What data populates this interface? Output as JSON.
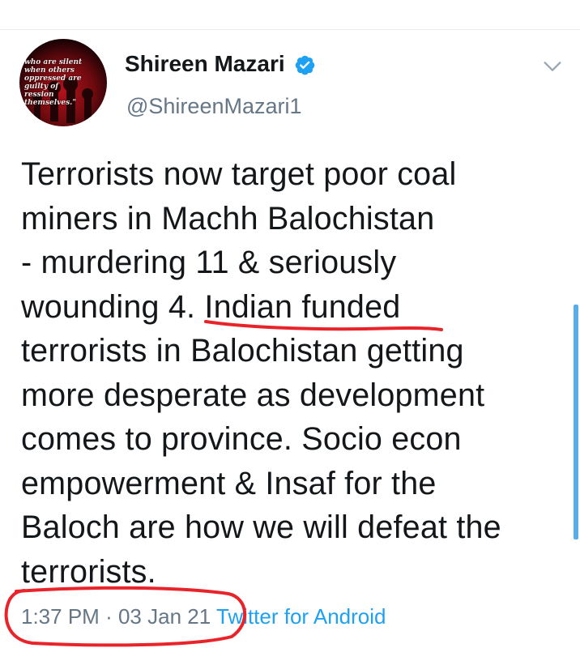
{
  "tweet": {
    "author": {
      "display_name": "Shireen Mazari",
      "handle": "@ShireenMazari1",
      "verified": true,
      "avatar_caption": "who are silent when others\noppressed are guilty of\nression themselves.\""
    },
    "text_lines": [
      "Terrorists now target poor coal",
      "miners in Machh Balochistan",
      "- murdering 11 & seriously",
      "wounding 4. Indian funded",
      "terrorists in Balochistan getting",
      "more desperate as development",
      "comes to province. Socio econ",
      "empowerment & Insaf for the",
      "Baloch are how we will defeat the",
      "terrorists."
    ],
    "time": "1:37 PM",
    "separator": "·",
    "date": "03 Jan 21",
    "source": "Twitter for Android"
  },
  "icons": {
    "verified": "verified-badge-icon",
    "more": "chevron-down-icon"
  },
  "colors": {
    "text_primary": "#14171a",
    "text_secondary": "#657786",
    "link": "#1da1f2",
    "verified_badge": "#1da1f2",
    "annotation_red": "#e8242a",
    "scrollbar": "#5aaee8"
  }
}
